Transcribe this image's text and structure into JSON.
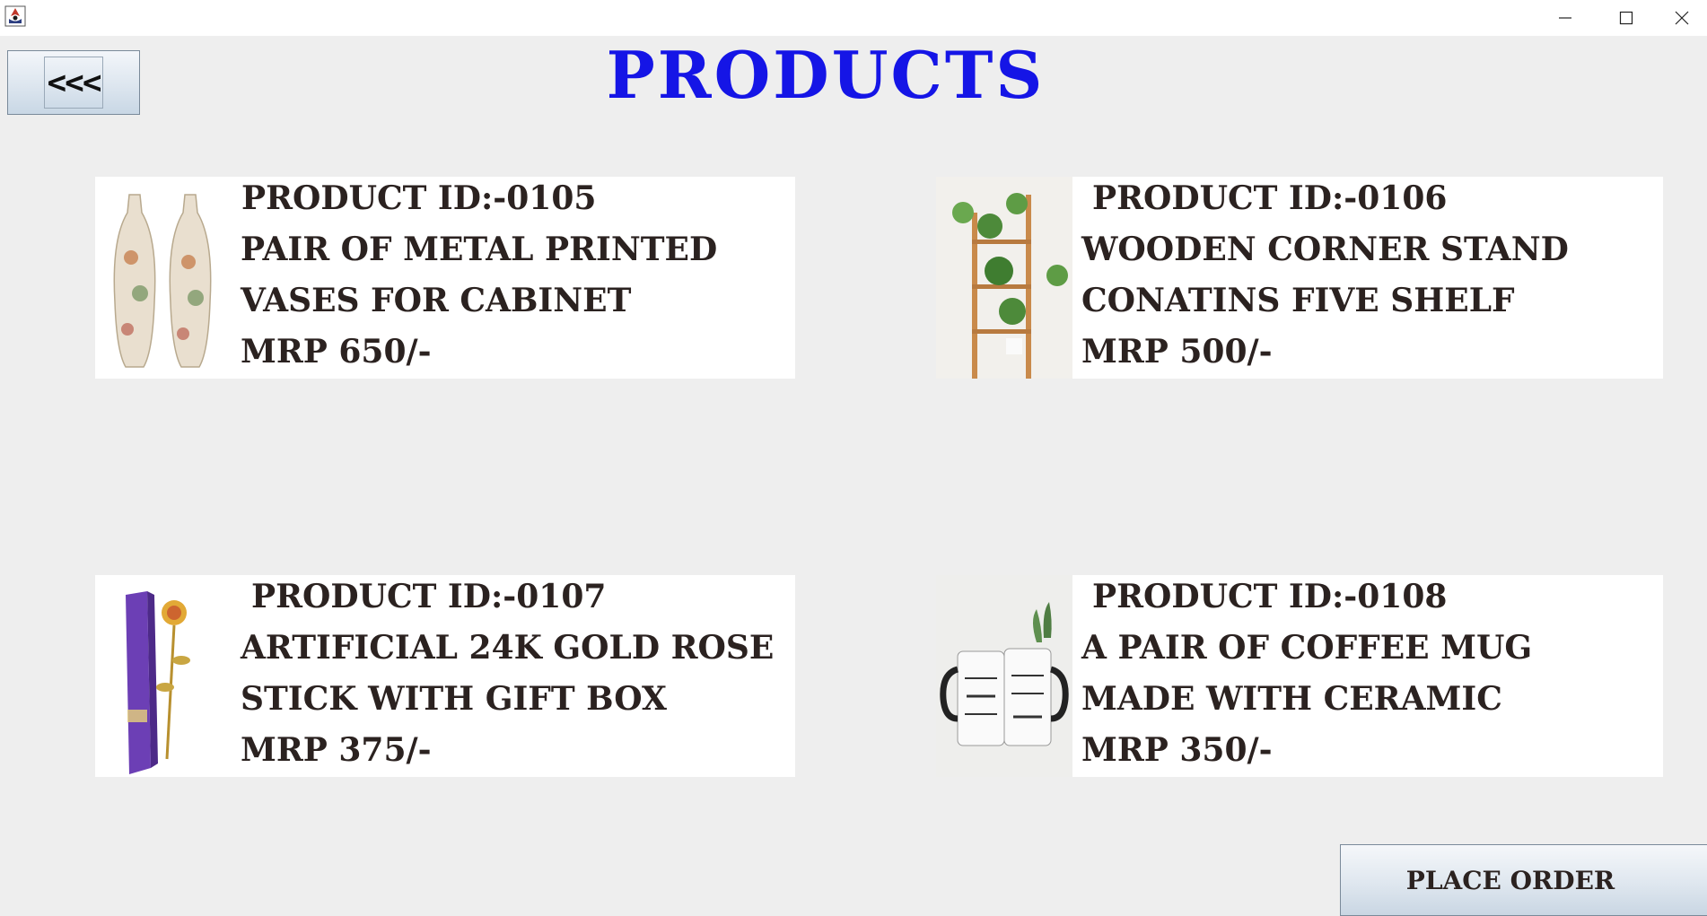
{
  "window": {
    "icons": {
      "app": "java-app-icon",
      "minimize": "minimize-icon",
      "maximize": "maximize-icon",
      "close": "close-icon"
    }
  },
  "back_button": {
    "label": "<<<"
  },
  "page_title": "PRODUCTS",
  "products": [
    {
      "id_text": "PRODUCT ID:-0105",
      "name_line1": "PAIR OF METAL PRINTED",
      "name_line2": "VASES FOR CABINET",
      "price": "MRP 650/-",
      "image_icon": "vases-image"
    },
    {
      "id_text": "PRODUCT ID:-0106",
      "name_line1": "WOODEN CORNER STAND",
      "name_line2": "CONATINS FIVE SHELF",
      "price": "MRP 500/-",
      "image_icon": "plant-stand-image"
    },
    {
      "id_text": "PRODUCT ID:-0107",
      "name_line1": "ARTIFICIAL 24K GOLD ROSE",
      "name_line2": "STICK WITH GIFT BOX",
      "price": "MRP 375/-",
      "image_icon": "gold-rose-image"
    },
    {
      "id_text": "PRODUCT ID:-0108",
      "name_line1": "A PAIR OF COFFEE MUG",
      "name_line2": "MADE WITH CERAMIC",
      "price": "MRP 350/-",
      "image_icon": "coffee-mugs-image"
    }
  ],
  "place_order": {
    "label": "PLACE ORDER"
  },
  "colors": {
    "title": "#1515e6",
    "background": "#eeeeee",
    "card": "#ffffff",
    "text": "#2b2220"
  }
}
